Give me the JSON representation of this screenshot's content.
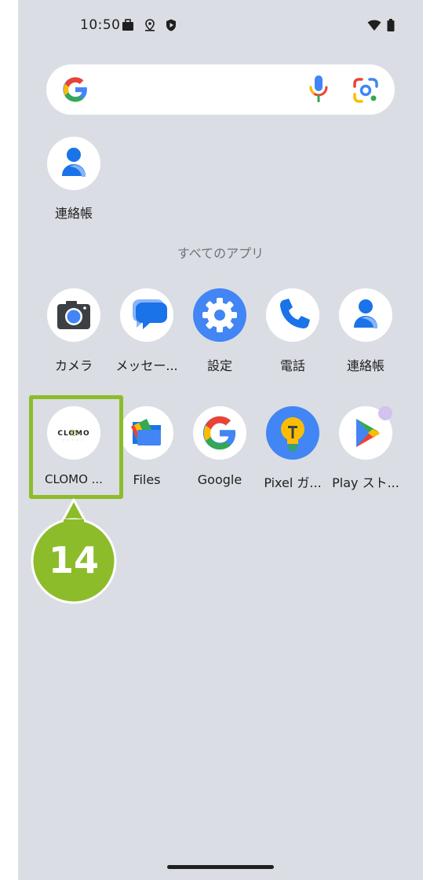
{
  "status_bar": {
    "time": "10:50",
    "icons": [
      "briefcase-icon",
      "location-icon",
      "shield-play-icon",
      "wifi-icon",
      "battery-icon"
    ]
  },
  "search_bar": {
    "icons": [
      "google-g-icon",
      "microphone-icon",
      "google-lens-icon"
    ]
  },
  "suggested_apps": [
    {
      "label": "連絡帳",
      "icon": "contacts-icon"
    }
  ],
  "all_apps": {
    "title": "すべてのアプリ",
    "rows": [
      [
        {
          "label": "カメラ",
          "icon": "camera-icon"
        },
        {
          "label": "メッセー...",
          "icon": "messages-icon"
        },
        {
          "label": "設定",
          "icon": "settings-gear-icon"
        },
        {
          "label": "電話",
          "icon": "phone-icon"
        },
        {
          "label": "連絡帳",
          "icon": "contacts-icon"
        }
      ],
      [
        {
          "label": "CLOMO ...",
          "icon": "clomo-icon",
          "logo_text": "CLOMO"
        },
        {
          "label": "Files",
          "icon": "files-icon"
        },
        {
          "label": "Google",
          "icon": "google-icon"
        },
        {
          "label": "Pixel ガ...",
          "icon": "pixel-tips-icon"
        },
        {
          "label": "Play スト...",
          "icon": "play-store-icon"
        }
      ]
    ]
  },
  "annotation": {
    "step_number": "14",
    "highlight_color": "#8cbc2a"
  },
  "colors": {
    "background": "#dadde3",
    "google_blue": "#4285f4",
    "google_red": "#ea4335",
    "google_yellow": "#fbbc04",
    "google_green": "#34a853"
  }
}
